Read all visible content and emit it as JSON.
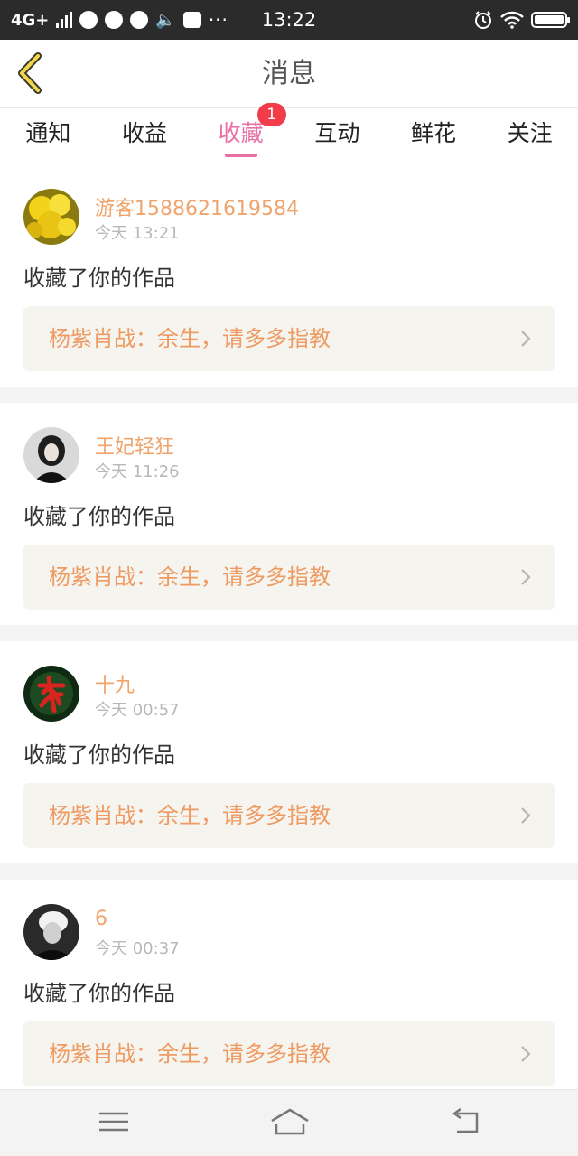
{
  "status_bar": {
    "network": "4G+",
    "time": "13:22",
    "more": "···"
  },
  "header": {
    "title": "消息"
  },
  "tabs": [
    {
      "label": "通知"
    },
    {
      "label": "收益"
    },
    {
      "label": "收藏",
      "active": true,
      "badge": "1"
    },
    {
      "label": "互动"
    },
    {
      "label": "鲜花"
    },
    {
      "label": "关注"
    }
  ],
  "messages": [
    {
      "user": "游客1588621619584",
      "time": "今天 13:21",
      "action": "收藏了你的作品",
      "work_title": "杨紫肖战：余生，请多多指教"
    },
    {
      "user": "王妃轻狂",
      "time": "今天 11:26",
      "action": "收藏了你的作品",
      "work_title": "杨紫肖战：余生，请多多指教"
    },
    {
      "user": "十九",
      "time": "今天 00:57",
      "action": "收藏了你的作品",
      "work_title": "杨紫肖战：余生，请多多指教"
    },
    {
      "user": "6",
      "time": "今天 00:37",
      "action": "收藏了你的作品",
      "work_title": "杨紫肖战：余生，请多多指教"
    }
  ],
  "colors": {
    "accent": "#e96fa4",
    "badge": "#f13c4a",
    "username": "#f0a36b",
    "work_title": "#ee9a62"
  }
}
